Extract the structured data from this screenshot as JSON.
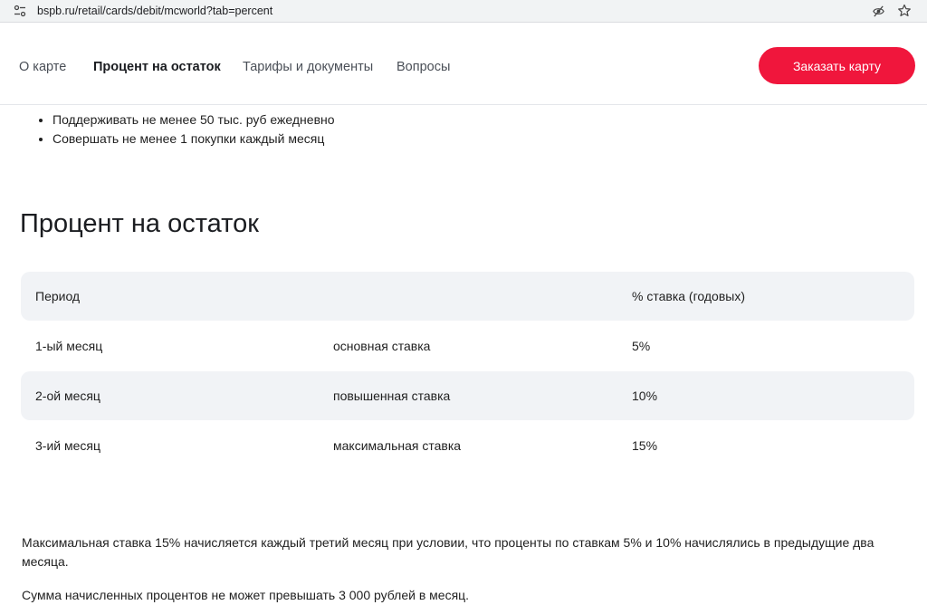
{
  "browser": {
    "url": "bspb.ru/retail/cards/debit/mcworld?tab=percent"
  },
  "nav": {
    "items": [
      {
        "label": "О карте"
      },
      {
        "label": "Процент на остаток"
      },
      {
        "label": "Тарифы и документы"
      },
      {
        "label": "Вопросы"
      }
    ],
    "active_index": 1,
    "order_button": "Заказать карту",
    "accent_color": "#f0163c"
  },
  "conditions": [
    "Поддерживать не менее 50 тыс. руб ежедневно",
    "Совершать не менее 1 покупки каждый месяц"
  ],
  "section": {
    "title": "Процент на остаток"
  },
  "rate_table": {
    "headers": [
      "Период",
      "",
      "% ставка (годовых)"
    ],
    "rows": [
      [
        "1-ый месяц",
        "основная ставка",
        "5%"
      ],
      [
        "2-ой месяц",
        "повышенная ставка",
        "10%"
      ],
      [
        "3-ий месяц",
        "максимальная ставка",
        "15%"
      ]
    ]
  },
  "notes": [
    "Максимальная ставка 15%  начисляется каждый третий месяц при условии, что проценты по ставкам 5% и 10% начислялись в предыдущие два месяца.",
    "Сумма начисленных процентов не может превышать 3 000 рублей в месяц."
  ]
}
